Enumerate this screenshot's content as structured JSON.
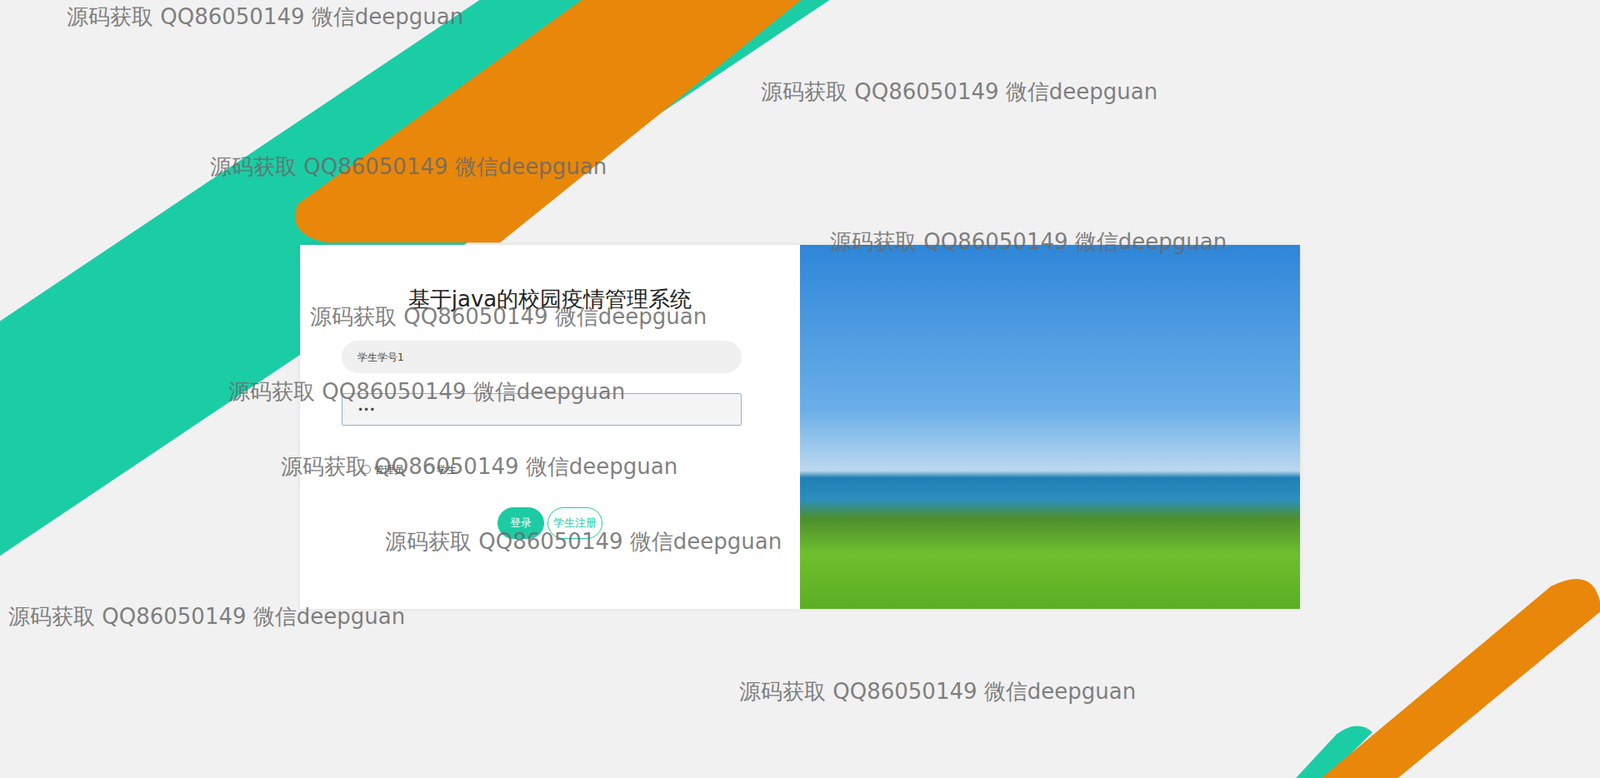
{
  "title": "基于java的校园疫情管理系统",
  "username": {
    "value": "学生学号1"
  },
  "password": {
    "value": "•••"
  },
  "roles": [
    {
      "label": "管理员",
      "selected": false
    },
    {
      "label": "学生",
      "selected": false
    }
  ],
  "buttons": [
    {
      "label": "登录",
      "kind": "primary"
    },
    {
      "label": "学生注册",
      "kind": "outline"
    }
  ],
  "watermarks": [
    "源码获取 QQ86050149 微信deepguan",
    "源码获取 QQ86050149 微信deepguan",
    "源码获取 QQ86050149 微信deepguan",
    "源码获取 QQ86050149 微信deepguan",
    "源码获取 QQ86050149 微信deepguan",
    "源码获取 QQ86050149 微信deepguan",
    "源码获取 QQ86050149 微信deepguan",
    "源码获取 QQ86050149 微信deepguan",
    "源码获取 QQ86050149 微信deepguan",
    "源码获取 QQ86050149 微信deepguan"
  ]
}
